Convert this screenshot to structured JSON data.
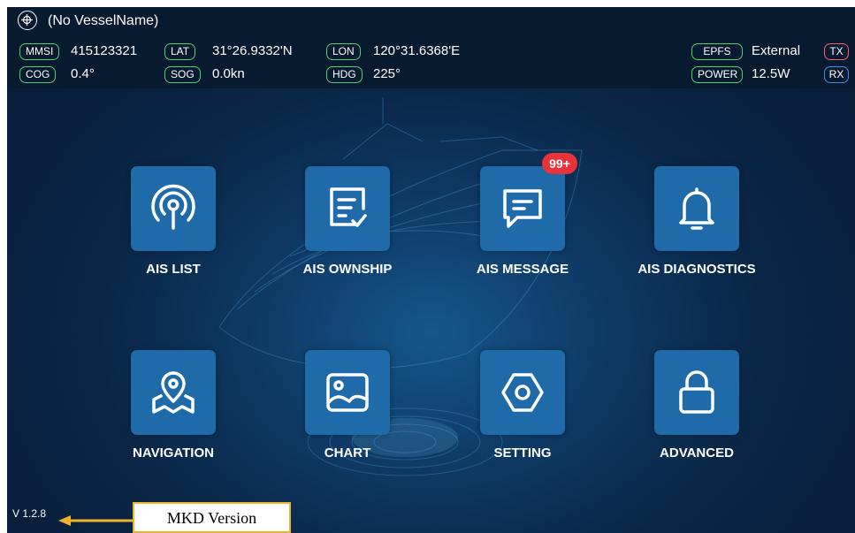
{
  "status": {
    "vessel_name": "(No VesselName)",
    "mmsi": {
      "label": "MMSI",
      "value": "415123321"
    },
    "lat": {
      "label": "LAT",
      "value": "31°26.9332'N"
    },
    "lon": {
      "label": "LON",
      "value": "120°31.6368'E"
    },
    "cog": {
      "label": "COG",
      "value": "0.4°"
    },
    "sog": {
      "label": "SOG",
      "value": "0.0kn"
    },
    "hdg": {
      "label": "HDG",
      "value": "225°"
    },
    "epfs": {
      "label": "EPFS",
      "value": "External"
    },
    "power": {
      "label": "POWER",
      "value": "12.5W"
    },
    "tx": "TX",
    "rx": "RX"
  },
  "menu": {
    "ais_list": "AIS LIST",
    "ais_ownship": "AIS OWNSHIP",
    "ais_message": "AIS MESSAGE",
    "ais_message_badge": "99+",
    "ais_diagnostics": "AIS DIAGNOSTICS",
    "navigation": "NAVIGATION",
    "chart": "CHART",
    "setting": "SETTING",
    "advanced": "ADVANCED"
  },
  "version": "V 1.2.8",
  "annotation": "MKD Version",
  "colors": {
    "tile": "#1f6aa8",
    "badge_green": "#4fd06a",
    "badge_red": "#ff5b6b",
    "badge_blue": "#3d8df0",
    "notification": "#e8333a",
    "annotation_border": "#f1b32a"
  }
}
